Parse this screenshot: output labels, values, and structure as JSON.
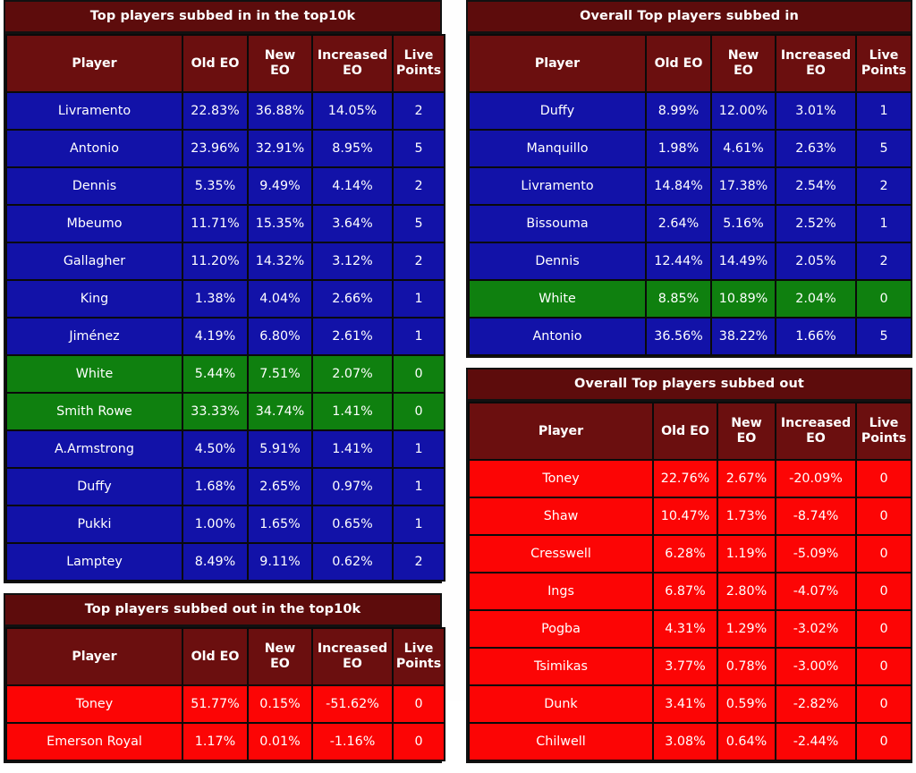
{
  "columns": [
    "Player",
    "Old EO",
    "New\nEO",
    "Increased\nEO",
    "Live\nPoints"
  ],
  "column_labels": {
    "player": "Player",
    "old_eo": "Old EO",
    "new_eo_line1": "New",
    "new_eo_line2": "EO",
    "increased_eo_line1": "Increased",
    "increased_eo_line2": "EO",
    "live_points_line1": "Live",
    "live_points_line2": "Points"
  },
  "colors": {
    "title_bar": "#5d0c0c",
    "header": "#6b0f0f",
    "row_blue": "#1212a8",
    "row_green": "#0f800f",
    "row_red": "#fc0505",
    "border": "#0a0a0a",
    "text": "#ffffff"
  },
  "panels": [
    {
      "id": "top-players-subbed-in-top10k",
      "title": "Top players subbed in in the top10k",
      "rows": [
        {
          "player": "Livramento",
          "old_eo": "22.83%",
          "new_eo": "36.88%",
          "increased_eo": "14.05%",
          "live_points": "2",
          "color": "blue"
        },
        {
          "player": "Antonio",
          "old_eo": "23.96%",
          "new_eo": "32.91%",
          "increased_eo": "8.95%",
          "live_points": "5",
          "color": "blue"
        },
        {
          "player": "Dennis",
          "old_eo": "5.35%",
          "new_eo": "9.49%",
          "increased_eo": "4.14%",
          "live_points": "2",
          "color": "blue"
        },
        {
          "player": "Mbeumo",
          "old_eo": "11.71%",
          "new_eo": "15.35%",
          "increased_eo": "3.64%",
          "live_points": "5",
          "color": "blue"
        },
        {
          "player": "Gallagher",
          "old_eo": "11.20%",
          "new_eo": "14.32%",
          "increased_eo": "3.12%",
          "live_points": "2",
          "color": "blue"
        },
        {
          "player": "King",
          "old_eo": "1.38%",
          "new_eo": "4.04%",
          "increased_eo": "2.66%",
          "live_points": "1",
          "color": "blue"
        },
        {
          "player": "Jiménez",
          "old_eo": "4.19%",
          "new_eo": "6.80%",
          "increased_eo": "2.61%",
          "live_points": "1",
          "color": "blue"
        },
        {
          "player": "White",
          "old_eo": "5.44%",
          "new_eo": "7.51%",
          "increased_eo": "2.07%",
          "live_points": "0",
          "color": "green"
        },
        {
          "player": "Smith Rowe",
          "old_eo": "33.33%",
          "new_eo": "34.74%",
          "increased_eo": "1.41%",
          "live_points": "0",
          "color": "green"
        },
        {
          "player": "A.Armstrong",
          "old_eo": "4.50%",
          "new_eo": "5.91%",
          "increased_eo": "1.41%",
          "live_points": "1",
          "color": "blue"
        },
        {
          "player": "Duffy",
          "old_eo": "1.68%",
          "new_eo": "2.65%",
          "increased_eo": "0.97%",
          "live_points": "1",
          "color": "blue"
        },
        {
          "player": "Pukki",
          "old_eo": "1.00%",
          "new_eo": "1.65%",
          "increased_eo": "0.65%",
          "live_points": "1",
          "color": "blue"
        },
        {
          "player": "Lamptey",
          "old_eo": "8.49%",
          "new_eo": "9.11%",
          "increased_eo": "0.62%",
          "live_points": "2",
          "color": "blue"
        }
      ]
    },
    {
      "id": "top-players-subbed-out-top10k",
      "title": "Top players subbed out in the top10k",
      "rows": [
        {
          "player": "Toney",
          "old_eo": "51.77%",
          "new_eo": "0.15%",
          "increased_eo": "-51.62%",
          "live_points": "0",
          "color": "red"
        },
        {
          "player": "Emerson Royal",
          "old_eo": "1.17%",
          "new_eo": "0.01%",
          "increased_eo": "-1.16%",
          "live_points": "0",
          "color": "red"
        }
      ]
    },
    {
      "id": "overall-top-players-subbed-in",
      "title": "Overall Top players subbed in",
      "rows": [
        {
          "player": "Duffy",
          "old_eo": "8.99%",
          "new_eo": "12.00%",
          "increased_eo": "3.01%",
          "live_points": "1",
          "color": "blue"
        },
        {
          "player": "Manquillo",
          "old_eo": "1.98%",
          "new_eo": "4.61%",
          "increased_eo": "2.63%",
          "live_points": "5",
          "color": "blue"
        },
        {
          "player": "Livramento",
          "old_eo": "14.84%",
          "new_eo": "17.38%",
          "increased_eo": "2.54%",
          "live_points": "2",
          "color": "blue"
        },
        {
          "player": "Bissouma",
          "old_eo": "2.64%",
          "new_eo": "5.16%",
          "increased_eo": "2.52%",
          "live_points": "1",
          "color": "blue"
        },
        {
          "player": "Dennis",
          "old_eo": "12.44%",
          "new_eo": "14.49%",
          "increased_eo": "2.05%",
          "live_points": "2",
          "color": "blue"
        },
        {
          "player": "White",
          "old_eo": "8.85%",
          "new_eo": "10.89%",
          "increased_eo": "2.04%",
          "live_points": "0",
          "color": "green"
        },
        {
          "player": "Antonio",
          "old_eo": "36.56%",
          "new_eo": "38.22%",
          "increased_eo": "1.66%",
          "live_points": "5",
          "color": "blue"
        }
      ]
    },
    {
      "id": "overall-top-players-subbed-out",
      "title": "Overall Top players subbed out",
      "rows": [
        {
          "player": "Toney",
          "old_eo": "22.76%",
          "new_eo": "2.67%",
          "increased_eo": "-20.09%",
          "live_points": "0",
          "color": "red"
        },
        {
          "player": "Shaw",
          "old_eo": "10.47%",
          "new_eo": "1.73%",
          "increased_eo": "-8.74%",
          "live_points": "0",
          "color": "red"
        },
        {
          "player": "Cresswell",
          "old_eo": "6.28%",
          "new_eo": "1.19%",
          "increased_eo": "-5.09%",
          "live_points": "0",
          "color": "red"
        },
        {
          "player": "Ings",
          "old_eo": "6.87%",
          "new_eo": "2.80%",
          "increased_eo": "-4.07%",
          "live_points": "0",
          "color": "red"
        },
        {
          "player": "Pogba",
          "old_eo": "4.31%",
          "new_eo": "1.29%",
          "increased_eo": "-3.02%",
          "live_points": "0",
          "color": "red"
        },
        {
          "player": "Tsimikas",
          "old_eo": "3.77%",
          "new_eo": "0.78%",
          "increased_eo": "-3.00%",
          "live_points": "0",
          "color": "red"
        },
        {
          "player": "Dunk",
          "old_eo": "3.41%",
          "new_eo": "0.59%",
          "increased_eo": "-2.82%",
          "live_points": "0",
          "color": "red"
        },
        {
          "player": "Chilwell",
          "old_eo": "3.08%",
          "new_eo": "0.64%",
          "increased_eo": "-2.44%",
          "live_points": "0",
          "color": "red"
        }
      ]
    }
  ]
}
